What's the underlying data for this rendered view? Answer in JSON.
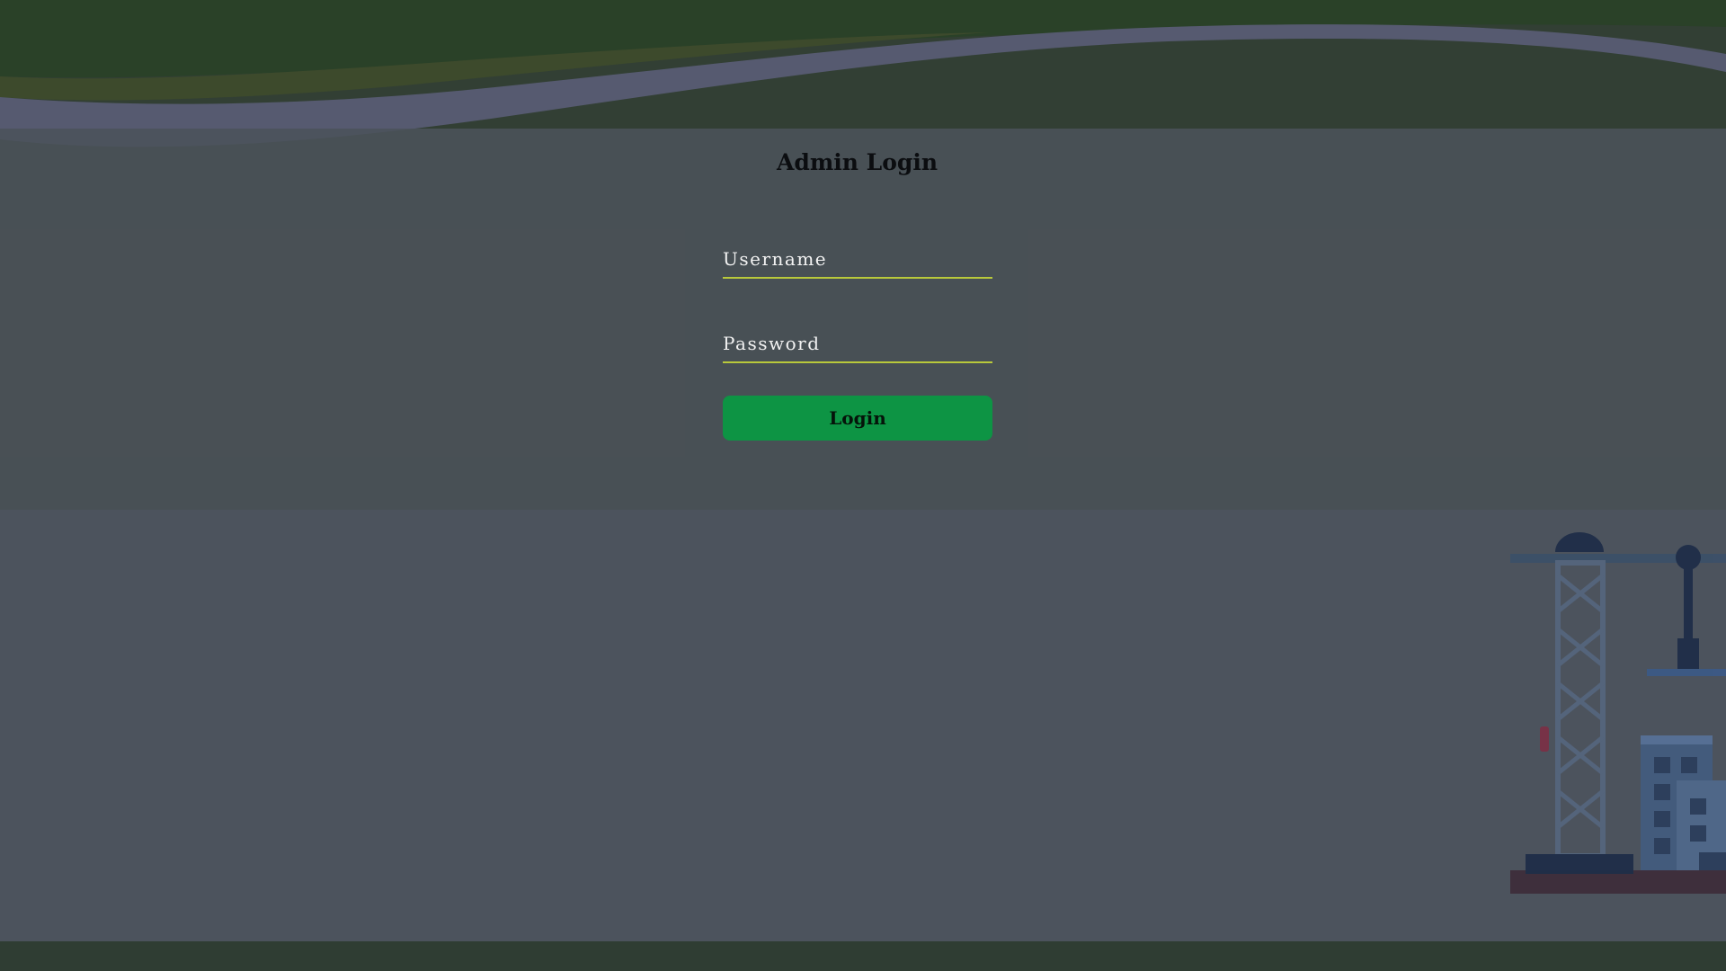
{
  "login": {
    "title": "Admin Login",
    "username": {
      "value": "",
      "placeholder": "Username"
    },
    "password": {
      "value": "",
      "placeholder": "Password"
    },
    "submit_label": "Login"
  },
  "colors": {
    "accent_button": "#0d9444",
    "field_underline": "#b9c93b",
    "header_green": "#2a4128",
    "road_gray": "#565a70",
    "page_background": "#4c535d"
  },
  "background": {
    "illustration": "construction-scene",
    "icons": [
      "hill-icon",
      "road-icon",
      "crane-icon",
      "building-icon"
    ]
  }
}
